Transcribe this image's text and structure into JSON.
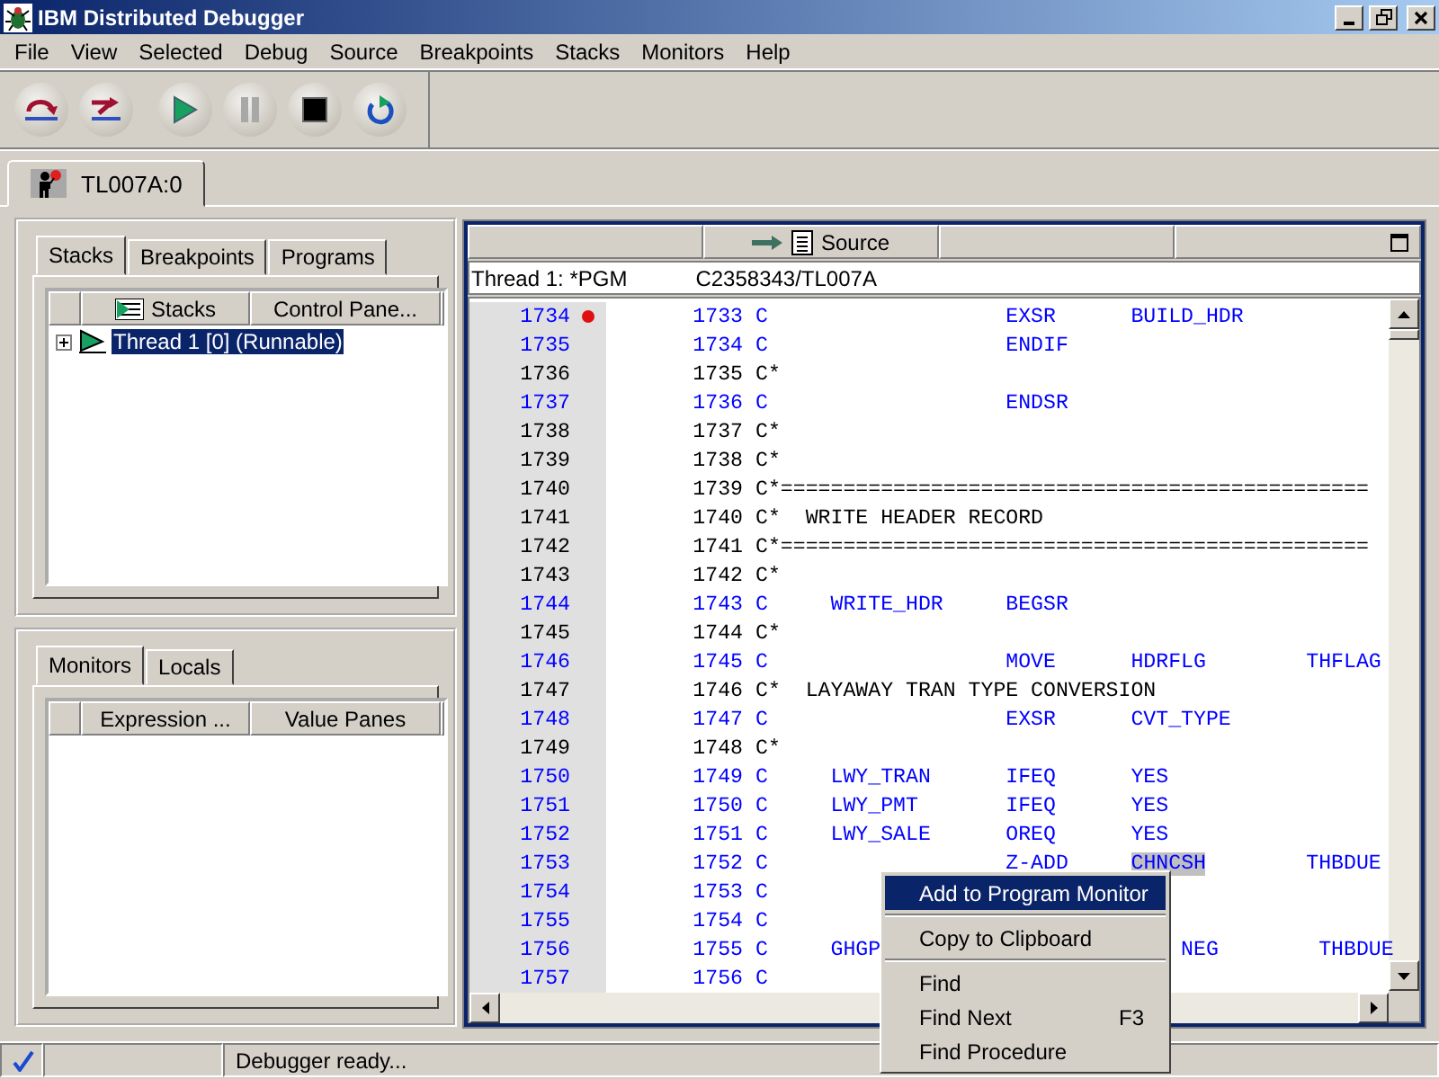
{
  "window": {
    "title": "IBM Distributed Debugger"
  },
  "menu": [
    {
      "label": "File"
    },
    {
      "label": "View"
    },
    {
      "label": "Selected"
    },
    {
      "label": "Debug"
    },
    {
      "label": "Source"
    },
    {
      "label": "Breakpoints"
    },
    {
      "label": "Stacks"
    },
    {
      "label": "Monitors"
    },
    {
      "label": "Help"
    }
  ],
  "toolbar": [
    {
      "kind": "step_over"
    },
    {
      "kind": "step_debug"
    },
    {
      "kind": "run"
    },
    {
      "kind": "halt",
      "disabled": true
    },
    {
      "kind": "stop"
    },
    {
      "kind": "restart"
    }
  ],
  "program_tabs": [
    {
      "label": "TL007A:0",
      "selected": true
    }
  ],
  "stacks_panel": {
    "tabs": [
      {
        "label": "Stacks",
        "selected": true
      },
      {
        "label": "Breakpoints",
        "selected": false
      },
      {
        "label": "Programs",
        "selected": false
      }
    ],
    "columns": [
      "Stacks",
      "Control Pane..."
    ],
    "tree": [
      {
        "label": "Thread 1 [0] (Runnable)",
        "selected": true,
        "expanded": false
      }
    ]
  },
  "monitors_panel": {
    "tabs": [
      {
        "label": "Monitors",
        "selected": true
      },
      {
        "label": "Locals",
        "selected": false
      }
    ],
    "columns": [
      "Expression ...",
      "Value Panes"
    ]
  },
  "source_pane": {
    "title": "Source",
    "thread": "Thread 1: *PGM",
    "program": "C2358343/TL007A",
    "lines": [
      {
        "line": "1734",
        "statement": "1733",
        "code": "C                   EXSR      BUILD_HDR",
        "executable": true,
        "breakpoint": true
      },
      {
        "line": "1735",
        "statement": "1734",
        "code": "C                   ENDIF",
        "executable": true,
        "breakpoint": false
      },
      {
        "line": "1736",
        "statement": "1735",
        "code": "C*",
        "executable": false,
        "breakpoint": false
      },
      {
        "line": "1737",
        "statement": "1736",
        "code": "C                   ENDSR",
        "executable": true,
        "breakpoint": false
      },
      {
        "line": "1738",
        "statement": "1737",
        "code": "C*",
        "executable": false,
        "breakpoint": false
      },
      {
        "line": "1739",
        "statement": "1738",
        "code": "C*",
        "executable": false,
        "breakpoint": false
      },
      {
        "line": "1740",
        "statement": "1739",
        "code": "C*===============================================",
        "executable": false,
        "breakpoint": false
      },
      {
        "line": "1741",
        "statement": "1740",
        "code": "C*  WRITE HEADER RECORD",
        "executable": false,
        "breakpoint": false
      },
      {
        "line": "1742",
        "statement": "1741",
        "code": "C*===============================================",
        "executable": false,
        "breakpoint": false
      },
      {
        "line": "1743",
        "statement": "1742",
        "code": "C*",
        "executable": false,
        "breakpoint": false
      },
      {
        "line": "1744",
        "statement": "1743",
        "code": "C     WRITE_HDR     BEGSR",
        "executable": true,
        "breakpoint": false
      },
      {
        "line": "1745",
        "statement": "1744",
        "code": "C*",
        "executable": false,
        "breakpoint": false
      },
      {
        "line": "1746",
        "statement": "1745",
        "code": "C                   MOVE      HDRFLG        THFLAG",
        "executable": true,
        "breakpoint": false
      },
      {
        "line": "1747",
        "statement": "1746",
        "code": "C*  LAYAWAY TRAN TYPE CONVERSION",
        "executable": false,
        "breakpoint": false
      },
      {
        "line": "1748",
        "statement": "1747",
        "code": "C                   EXSR      CVT_TYPE",
        "executable": true,
        "breakpoint": false
      },
      {
        "line": "1749",
        "statement": "1748",
        "code": "C*",
        "executable": false,
        "breakpoint": false
      },
      {
        "line": "1750",
        "statement": "1749",
        "code": "C     LWY_TRAN      IFEQ      YES",
        "executable": true,
        "breakpoint": false
      },
      {
        "line": "1751",
        "statement": "1750",
        "code": "C     LWY_PMT       IFEQ      YES",
        "executable": true,
        "breakpoint": false
      },
      {
        "line": "1752",
        "statement": "1751",
        "code": "C     LWY_SALE      OREQ      YES",
        "executable": true,
        "breakpoint": false
      },
      {
        "line": "1753",
        "statement": "1752",
        "code": "C                   Z-ADD     ",
        "selection": "CHNCSH",
        "code_after": "        THBDUE",
        "executable": true,
        "breakpoint": false
      },
      {
        "line": "1754",
        "statement": "1753",
        "code": "C",
        "executable": true,
        "breakpoint": false
      },
      {
        "line": "1755",
        "statement": "1754",
        "code": "C",
        "executable": true,
        "breakpoint": false
      },
      {
        "line": "1756",
        "statement": "1755",
        "code": "C     GHGP",
        "code_right": "NEG        THBDUE",
        "executable": true,
        "breakpoint": false
      },
      {
        "line": "1757",
        "statement": "1756",
        "code": "C",
        "executable": true,
        "breakpoint": false
      }
    ]
  },
  "context_menu": [
    {
      "kind": "item",
      "label": "Add to Program Monitor",
      "selected": true
    },
    {
      "kind": "separator"
    },
    {
      "kind": "item",
      "label": "Copy to Clipboard",
      "selected": false
    },
    {
      "kind": "separator"
    },
    {
      "kind": "item",
      "label": "Find",
      "selected": false
    },
    {
      "kind": "item",
      "label": "Find Next",
      "shortcut": "F3",
      "selected": false
    },
    {
      "kind": "item",
      "label": "Find Procedure",
      "selected": false
    }
  ],
  "status_bar": {
    "ready": true,
    "message": "Debugger ready..."
  }
}
